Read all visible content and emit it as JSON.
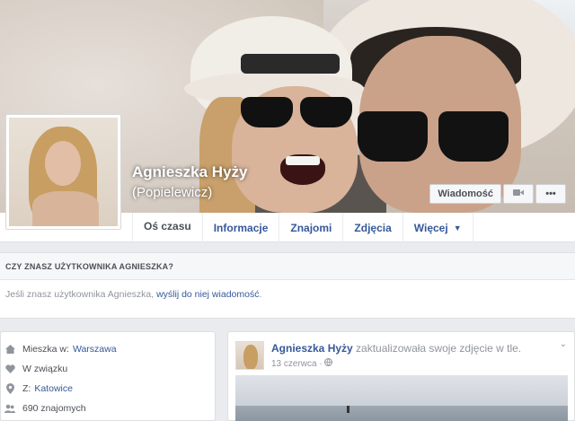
{
  "profile": {
    "name": "Agnieszka Hyży",
    "alt_name": "(Popielewicz)"
  },
  "actions": {
    "message": "Wiadomość",
    "video_icon": "video-camera-icon",
    "more": "•••"
  },
  "tabs": [
    {
      "label": "Oś czasu",
      "active": true
    },
    {
      "label": "Informacje"
    },
    {
      "label": "Znajomi"
    },
    {
      "label": "Zdjęcia"
    },
    {
      "label": "Więcej",
      "caret": "▼"
    }
  ],
  "know": {
    "heading": "CZY ZNASZ UŻYTKOWNIKA AGNIESZKA?",
    "text_before": "Jeśli znasz użytkownika Agnieszka, ",
    "link": "wyślij do niej wiadomość",
    "text_after": "."
  },
  "intro": {
    "lives_label": "Mieszka w:",
    "lives_value": "Warszawa",
    "relationship": "W związku",
    "from_label": "Z:",
    "from_value": "Katowice",
    "friends": "690 znajomych"
  },
  "post": {
    "author": "Agnieszka Hyży",
    "action": " zaktualizowała swoje zdjęcie w tle.",
    "date": "13 czerwca",
    "privacy": "·",
    "chevron": "⌄"
  },
  "colors": {
    "link": "#365899",
    "background": "#e9ebee"
  }
}
